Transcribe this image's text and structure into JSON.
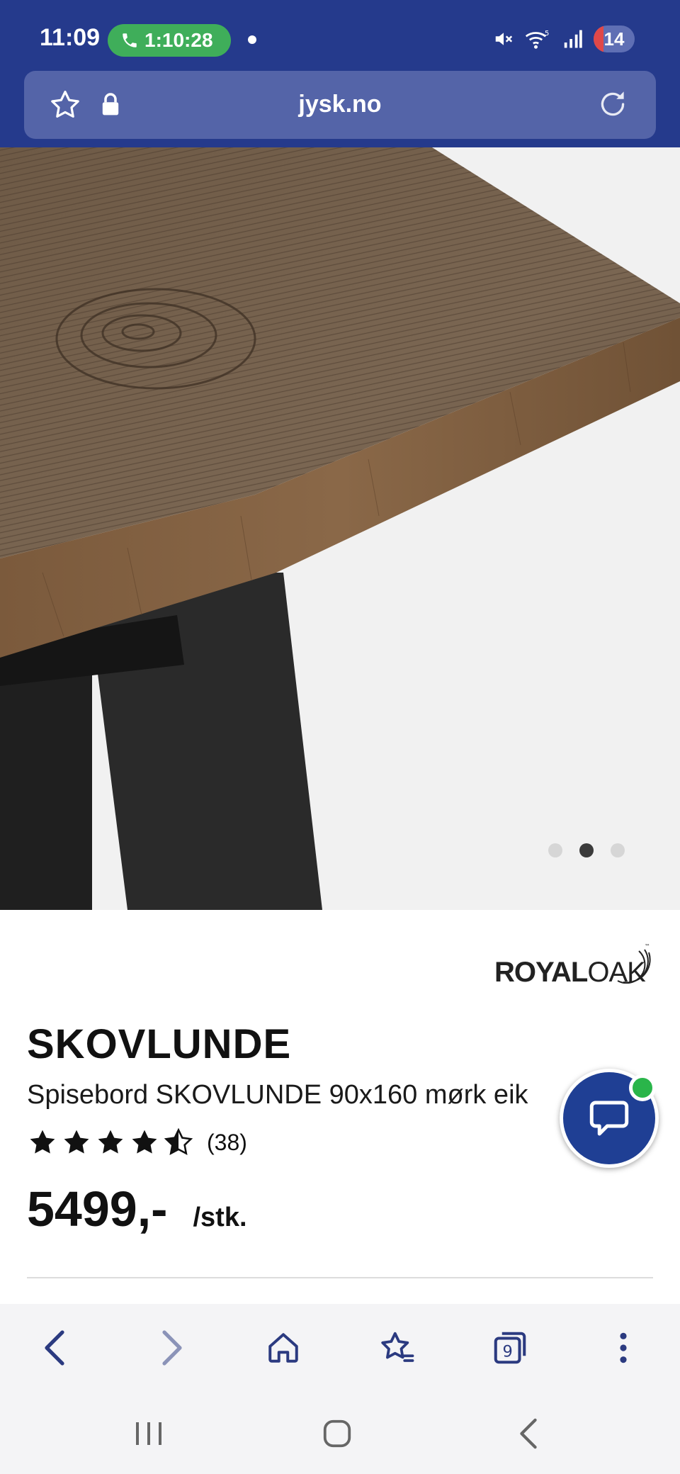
{
  "status_bar": {
    "time": "11:09",
    "call_timer": "1:10:28",
    "battery_level": "14"
  },
  "browser": {
    "url": "jysk.no",
    "tab_count": "9"
  },
  "carousel": {
    "total": 3,
    "active_index": 1
  },
  "product": {
    "brand": "ROYAL OAK",
    "brand_part1": "ROYAL",
    "brand_part2": "OAK",
    "brand_tm": "™",
    "name": "SKOVLUNDE",
    "description": "Spisebord SKOVLUNDE 90x160 mørk eik",
    "rating": 4.5,
    "rating_max": 5,
    "review_count": "(38)",
    "price": "5499,-",
    "unit": "/stk."
  },
  "colors": {
    "brand_blue": "#253a8c",
    "urlbar": "#5464a8",
    "chat_blue": "#1f3f94",
    "online_green": "#2ab54a",
    "call_green": "#3fae5a"
  },
  "icons": {
    "browser_toolbar": [
      "back-icon",
      "forward-icon",
      "home-icon",
      "bookmarks-icon",
      "tabs-icon",
      "more-icon"
    ],
    "system_nav": [
      "recents-icon",
      "home-circle-icon",
      "system-back-icon"
    ]
  }
}
